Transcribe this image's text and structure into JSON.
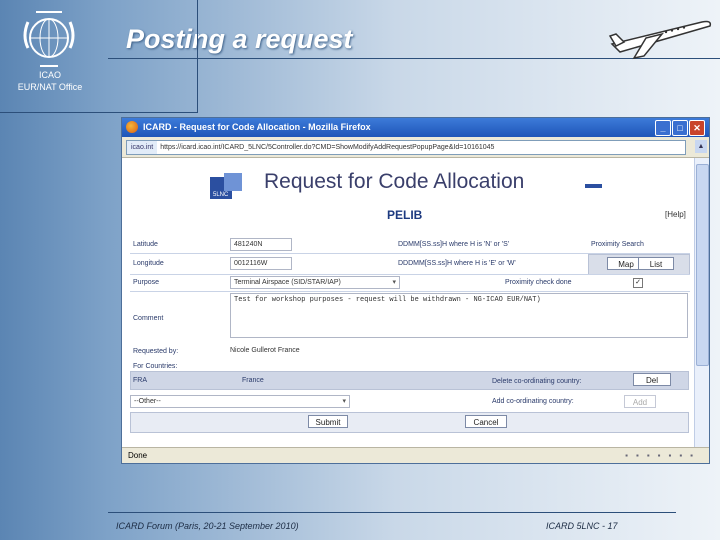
{
  "slide": {
    "title": "Posting a request",
    "org_line1": "ICAO",
    "org_line2": "EUR/NAT Office",
    "footer_left": "ICARD Forum (Paris, 20-21 September 2010)",
    "footer_right": "ICARD 5LNC - 17",
    "accent_color": "#2c4f7a"
  },
  "browser": {
    "window_title": "ICARD - Request for Code Allocation - Mozilla Firefox",
    "url_site": "icao.int",
    "url": "https://icard.icao.int/ICARD_5LNC/5Controller.do?CMD=ShowModifyAddRequestPopupPage&Id=10161045",
    "status": "Done",
    "minimize": "_",
    "maximize": "□",
    "close": "✕"
  },
  "form": {
    "logo_text": "5LNC",
    "heading": "Request for Code Allocation",
    "name_code": "PELIB",
    "help": "[Help]",
    "latitude_label": "Latitude",
    "latitude_value": "481240N",
    "longitude_label": "Longitude",
    "longitude_value": "0012116W",
    "lat_format_hint": "DDMM[SS.ss]H where H is 'N' or 'S'",
    "lon_format_hint": "DDDMM[SS.ss]H where H is 'E' or 'W'",
    "proximity_search": "Proximity Search",
    "map_button": "Map",
    "list_button": "List",
    "purpose_label": "Purpose",
    "purpose_value": "Terminal Airspace (SID/STAR/IAP)",
    "proximity_check_label": "Proximity check done",
    "proximity_check_mark": "✓",
    "comment_label": "Comment",
    "comment_value": "Test for workshop purposes - request will be withdrawn - NG-ICAO EUR/NAT)",
    "requested_by_label": "Requested by:",
    "requested_by_value": "Nicole Gullerot France",
    "for_countries_label": "For Countries:",
    "fra_code": "FRA",
    "fra_name": "France",
    "delete_country_label": "Delete co-ordinating country:",
    "delete_button": "Del",
    "country_select": "--Other--",
    "add_country_label": "Add co-ordinating country:",
    "add_button": "Add",
    "submit_button": "Submit",
    "cancel_button": "Cancel"
  }
}
